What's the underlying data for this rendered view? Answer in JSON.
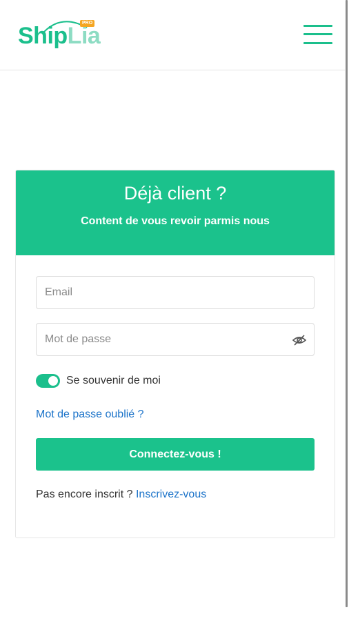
{
  "header": {
    "logo": {
      "text_primary": "Ship",
      "text_secondary": "Lia",
      "badge": "PRO"
    },
    "menu_icon": "hamburger-icon"
  },
  "login": {
    "title": "Déjà client ?",
    "subtitle": "Content de vous revoir parmis nous",
    "email_placeholder": "Email",
    "password_placeholder": "Mot de passe",
    "password_toggle_icon": "eye-slash-icon",
    "remember_label": "Se souvenir de moi",
    "remember_checked": true,
    "forgot_link": "Mot de passe oublié ?",
    "submit_label": "Connectez-vous !",
    "signup_prompt": "Pas encore inscrit ?",
    "signup_link": "Inscrivez-vous"
  },
  "colors": {
    "brand": "#1bc28c",
    "link": "#1b73c9",
    "badge": "#f5a623"
  }
}
